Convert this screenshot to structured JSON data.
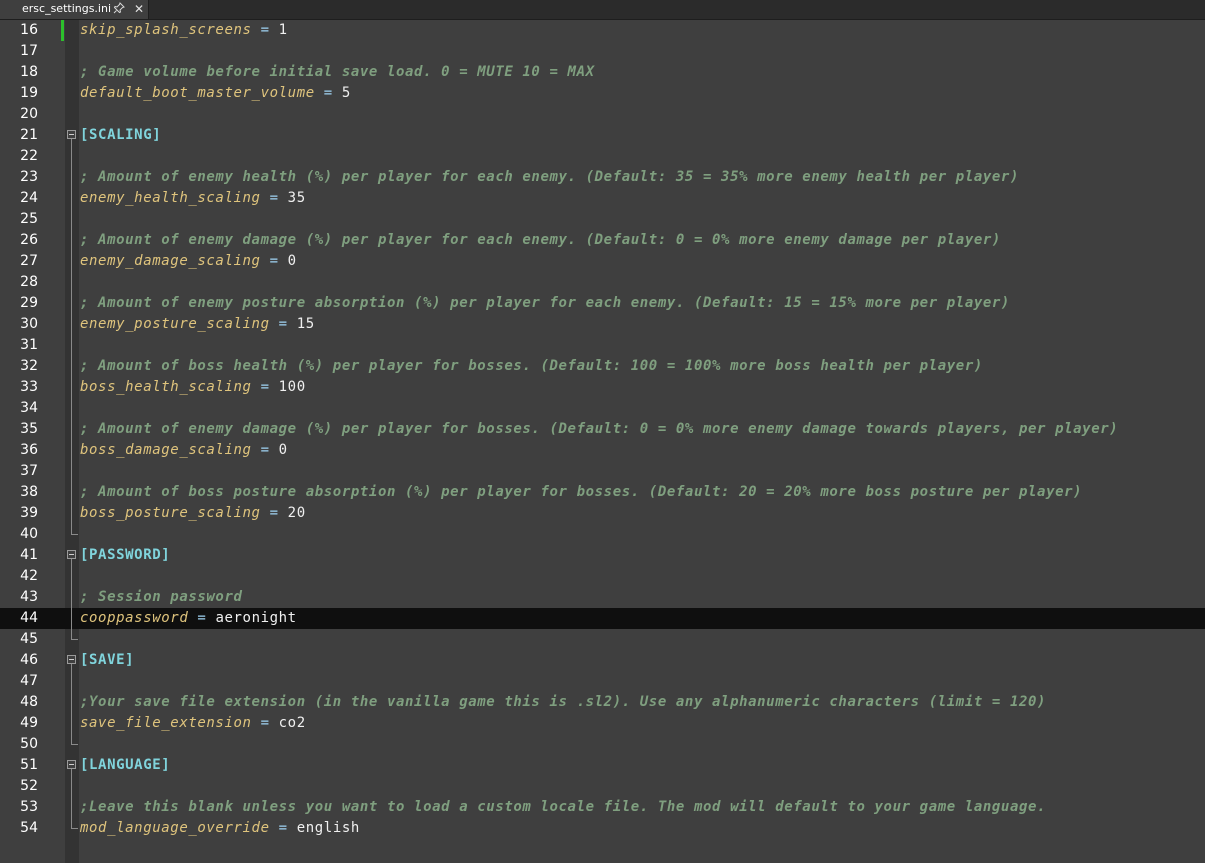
{
  "tab": {
    "title": "ersc_settings.ini"
  },
  "lines": [
    {
      "n": "16",
      "type": "kv",
      "key": "skip_splash_screens",
      "value": "1"
    },
    {
      "n": "17",
      "type": "blank"
    },
    {
      "n": "18",
      "type": "comment",
      "text": "; Game volume before initial save load. 0 = MUTE 10 = MAX"
    },
    {
      "n": "19",
      "type": "kv",
      "key": "default_boot_master_volume",
      "value": "5"
    },
    {
      "n": "20",
      "type": "blank"
    },
    {
      "n": "21",
      "type": "section",
      "text": "[SCALING]"
    },
    {
      "n": "22",
      "type": "blank"
    },
    {
      "n": "23",
      "type": "comment",
      "text": "; Amount of enemy health (%) per player for each enemy. (Default: 35 = 35% more enemy health per player)"
    },
    {
      "n": "24",
      "type": "kv",
      "key": "enemy_health_scaling",
      "value": "35"
    },
    {
      "n": "25",
      "type": "blank"
    },
    {
      "n": "26",
      "type": "comment",
      "text": "; Amount of enemy damage (%) per player for each enemy. (Default: 0 = 0% more enemy damage per player)"
    },
    {
      "n": "27",
      "type": "kv",
      "key": "enemy_damage_scaling",
      "value": "0"
    },
    {
      "n": "28",
      "type": "blank"
    },
    {
      "n": "29",
      "type": "comment",
      "text": "; Amount of enemy posture absorption (%) per player for each enemy. (Default: 15 = 15% more per player)"
    },
    {
      "n": "30",
      "type": "kv",
      "key": "enemy_posture_scaling",
      "value": "15"
    },
    {
      "n": "31",
      "type": "blank"
    },
    {
      "n": "32",
      "type": "comment",
      "text": "; Amount of boss health (%) per player for bosses. (Default: 100 = 100% more boss health per player)"
    },
    {
      "n": "33",
      "type": "kv",
      "key": "boss_health_scaling",
      "value": "100"
    },
    {
      "n": "34",
      "type": "blank"
    },
    {
      "n": "35",
      "type": "comment",
      "text": "; Amount of enemy damage (%) per player for bosses. (Default: 0 = 0% more enemy damage towards players, per player)"
    },
    {
      "n": "36",
      "type": "kv",
      "key": "boss_damage_scaling",
      "value": "0"
    },
    {
      "n": "37",
      "type": "blank"
    },
    {
      "n": "38",
      "type": "comment",
      "text": "; Amount of boss posture absorption (%) per player for bosses. (Default: 20 = 20% more boss posture per player)"
    },
    {
      "n": "39",
      "type": "kv",
      "key": "boss_posture_scaling",
      "value": "20"
    },
    {
      "n": "40",
      "type": "blank"
    },
    {
      "n": "41",
      "type": "section",
      "text": "[PASSWORD]"
    },
    {
      "n": "42",
      "type": "blank"
    },
    {
      "n": "43",
      "type": "comment",
      "text": "; Session password"
    },
    {
      "n": "44",
      "type": "kv",
      "key": "cooppassword",
      "value": "aeronight",
      "current": true
    },
    {
      "n": "45",
      "type": "blank"
    },
    {
      "n": "46",
      "type": "section",
      "text": "[SAVE]"
    },
    {
      "n": "47",
      "type": "blank"
    },
    {
      "n": "48",
      "type": "comment",
      "text": ";Your save file extension (in the vanilla game this is .sl2). Use any alphanumeric characters (limit = 120)"
    },
    {
      "n": "49",
      "type": "kv",
      "key": "save_file_extension",
      "value": "co2"
    },
    {
      "n": "50",
      "type": "blank"
    },
    {
      "n": "51",
      "type": "section",
      "text": "[LANGUAGE]"
    },
    {
      "n": "52",
      "type": "blank"
    },
    {
      "n": "53",
      "type": "comment",
      "text": ";Leave this blank unless you want to load a custom locale file. The mod will default to your game language."
    },
    {
      "n": "54",
      "type": "kv",
      "key": "mod_language_override",
      "value": "english"
    }
  ],
  "colors": {
    "background": "#3f3f3f",
    "comment": "#7f9f7f",
    "key": "#dfc47d",
    "section": "#80d4dc",
    "current_line": "#0f0f0f",
    "change_bar": "#2cc12c"
  },
  "icons": {
    "pin": "pin-icon",
    "close": "close-icon",
    "fold": "fold-minus-icon"
  }
}
